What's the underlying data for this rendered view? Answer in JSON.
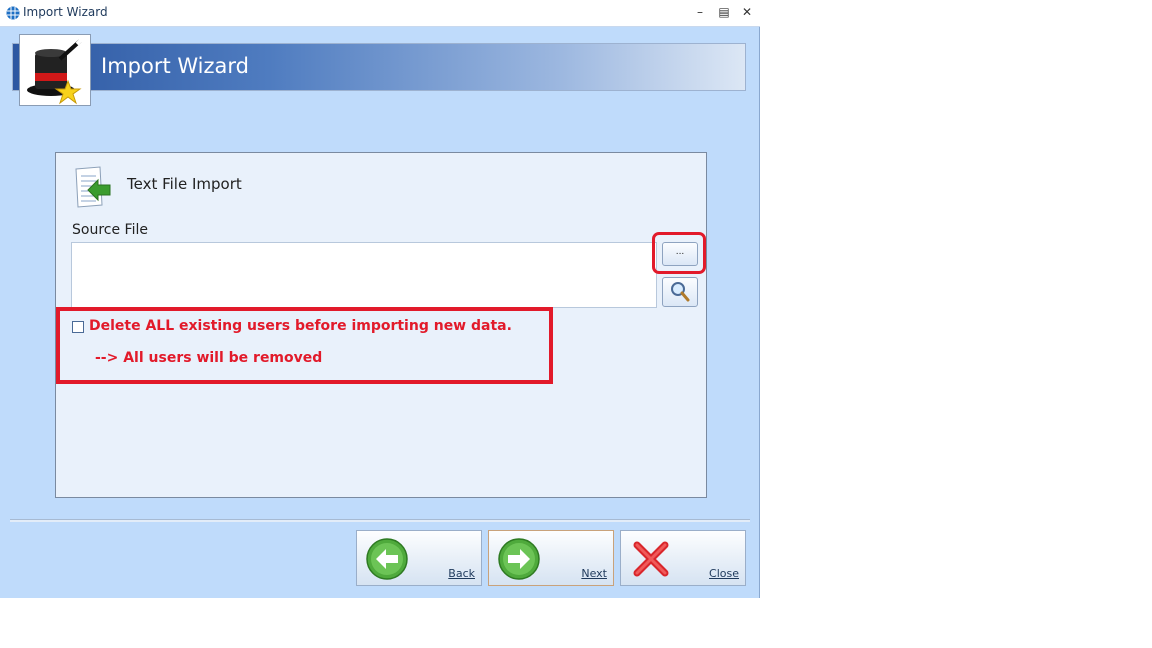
{
  "window": {
    "title": "Import Wizard"
  },
  "header": {
    "title": "Import Wizard"
  },
  "section": {
    "title": "Text File Import"
  },
  "source": {
    "label": "Source File",
    "value": "",
    "browse_label": "..."
  },
  "delete_option": {
    "checked": false,
    "label": "Delete ALL existing users before importing new data.",
    "note": "--> All users will be removed"
  },
  "buttons": {
    "back": "Back",
    "next": "Next",
    "close": "Close"
  },
  "colors": {
    "accent_red": "#e21a2a",
    "banner_blue": "#2c57a1",
    "window_bg": "#bfdbfb"
  },
  "icons": [
    "app-icon",
    "magic-hat-icon",
    "text-file-import-icon",
    "magnifier-icon",
    "back-arrow-icon",
    "next-arrow-icon",
    "close-x-icon"
  ]
}
